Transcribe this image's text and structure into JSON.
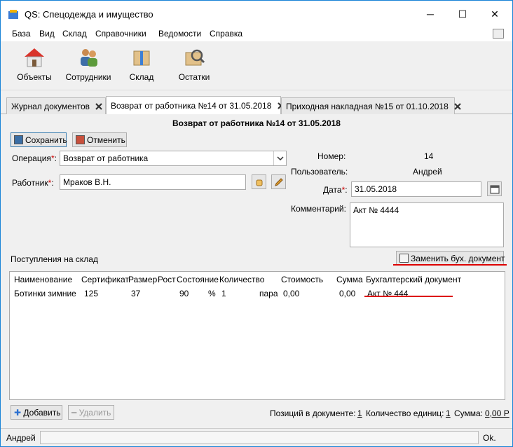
{
  "window": {
    "title": "QS: Спецодежда и имущество",
    "minimize": "─",
    "maximize": "☐",
    "close": "✕"
  },
  "menu": [
    "База",
    "Вид",
    "Склад",
    "Справочники",
    "Ведомости",
    "Справка"
  ],
  "toolbar": {
    "objects": "Объекты",
    "employees": "Сотрудники",
    "warehouse": "Склад",
    "balances": "Остатки"
  },
  "tabs": [
    {
      "label": "Журнал документов"
    },
    {
      "label": "Возврат от работника №14 от 31.05.2018"
    },
    {
      "label": "Приходная накладная №15 от 01.10.2018"
    }
  ],
  "doc": {
    "title": "Возврат от работника №14 от 31.05.2018",
    "save": "Сохранить",
    "cancel": "Отменить",
    "operation_label": "Операция",
    "operation_value": "Возврат от работника",
    "worker_label": "Работник",
    "worker_value": "Мраков В.Н.",
    "number_label": "Номер:",
    "number_value": "14",
    "user_label": "Пользователь:",
    "user_value": "Андрей",
    "date_label": "Дата",
    "date_value": "31.05.2018",
    "comment_label": "Комментарий:",
    "comment_value": "Акт № 4444",
    "req_mark": "*",
    "colon": ":"
  },
  "receipts": {
    "label": "Поступления на склад",
    "replace_button": "Заменить бух. документ",
    "columns": [
      "Наименование",
      "Сертификат",
      "Размер",
      "Рост",
      "Состояние",
      "Количество",
      "Стоимость",
      "Сумма",
      "Бухгалтерский документ"
    ],
    "rows": [
      {
        "name": "Ботинки зимние",
        "cert": "125",
        "size": "37",
        "state": "90",
        "pct": "%",
        "qty": "1",
        "unit": "пара",
        "cost": "0,00",
        "sum": "0,00",
        "doc": "Акт № 444"
      }
    ]
  },
  "footer": {
    "add": "Добавить",
    "delete": "Удалить",
    "positions_label": "Позиций в документе:",
    "positions_value": "1",
    "units_label": "Количество единиц:",
    "units_value": "1",
    "sum_label": "Сумма:",
    "sum_value": "0,00 Р"
  },
  "status": {
    "user": "Андрей",
    "state": "Ok."
  }
}
